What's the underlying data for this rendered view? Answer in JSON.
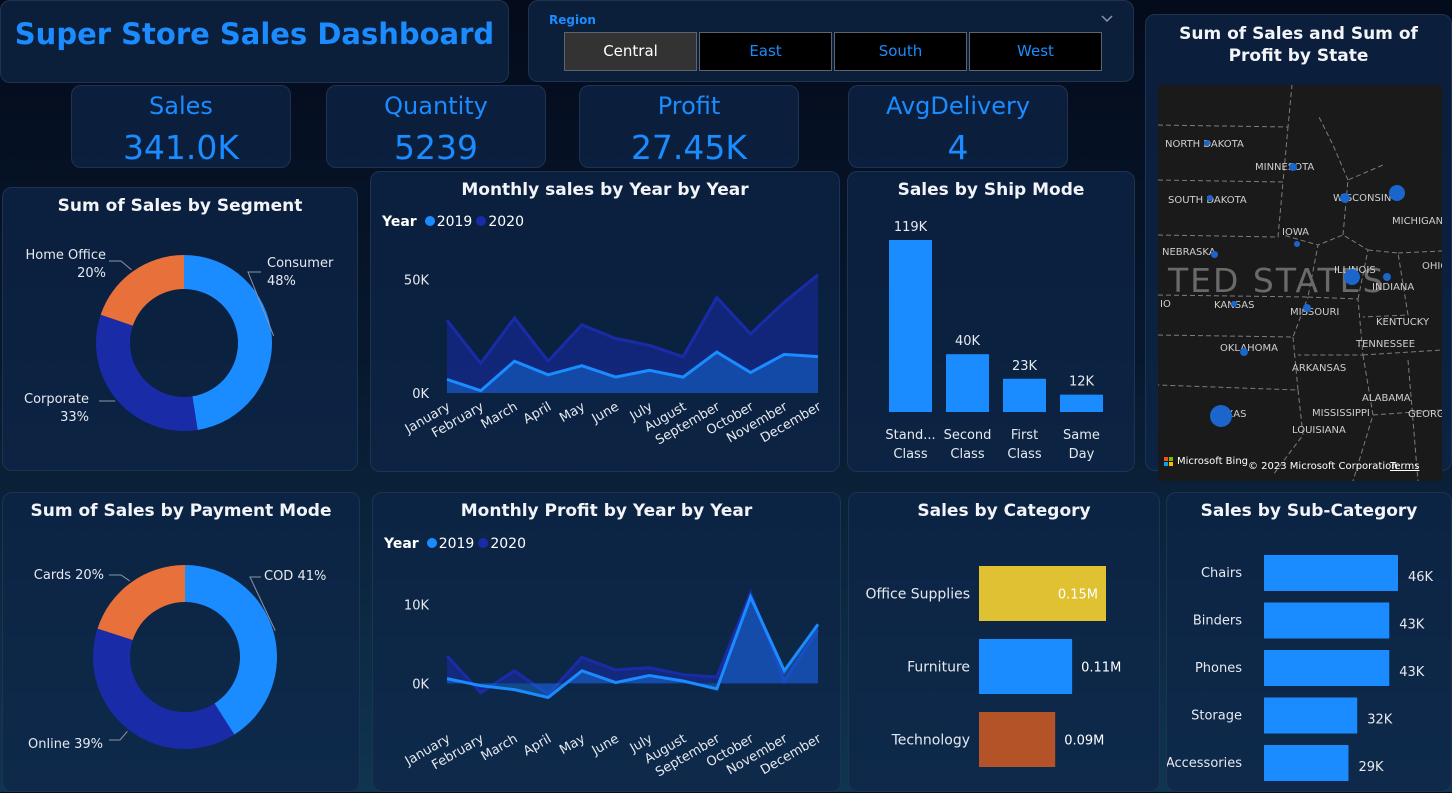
{
  "header": {
    "title": "Super Store Sales Dashboard"
  },
  "slicer": {
    "title": "Region",
    "options": [
      "Central",
      "East",
      "South",
      "West"
    ],
    "selected": "Central"
  },
  "kpis": [
    {
      "label": "Sales",
      "value": "341.0K"
    },
    {
      "label": "Quantity",
      "value": "5239"
    },
    {
      "label": "Profit",
      "value": "27.45K"
    },
    {
      "label": "AvgDelivery",
      "value": "4"
    }
  ],
  "colors": {
    "bright_blue": "#1a8cff",
    "navy": "#1a2ba8",
    "orange": "#e8703a",
    "yellow": "#e0c132",
    "rust": "#b45228"
  },
  "map": {
    "title": "Sum of Sales and Sum of Profit by State",
    "country_label": "TED STATES",
    "states": [
      "NORTH DAKOTA",
      "MINNESOTA",
      "WISCONSIN",
      "MICHIGAN",
      "SOUTH DAKOTA",
      "IOWA",
      "NEBRASKA",
      "ILLINOIS",
      "INDIANA",
      "OHIO",
      "KANSAS",
      "MISSOURI",
      "KENTUCKY",
      "TENNESSEE",
      "OKLAHOMA",
      "ARKANSAS",
      "ALABAMA",
      "MISSISSIPPI",
      "GEORGIA",
      "TEXAS",
      "LOUISIANA",
      "IO"
    ],
    "bing": "Microsoft Bing",
    "copyright": "© 2023 Microsoft Corporation",
    "terms": "Terms"
  },
  "charts": {
    "segment": {
      "title": "Sum of Sales by Segment",
      "chart_data": {
        "type": "pie",
        "slices": [
          {
            "label": "Consumer",
            "pct": "48%",
            "value": 48,
            "color": "#1a8cff"
          },
          {
            "label": "Corporate",
            "pct": "33%",
            "value": 33,
            "color": "#1a2ba8"
          },
          {
            "label": "Home Office",
            "pct": "20%",
            "value": 20,
            "color": "#e8703a"
          }
        ]
      }
    },
    "monthly_sales": {
      "title": "Monthly sales by Year by Year",
      "legend_title": "Year",
      "chart_data": {
        "type": "area",
        "categories": [
          "January",
          "February",
          "March",
          "April",
          "May",
          "June",
          "July",
          "August",
          "September",
          "October",
          "November",
          "December"
        ],
        "series": [
          {
            "name": "2019",
            "values": [
              6,
              1,
              14,
              8,
              12,
              7,
              10,
              7,
              18,
              9,
              17,
              16
            ],
            "color": "#1a8cff"
          },
          {
            "name": "2020",
            "values": [
              32,
              13,
              33,
              14,
              30,
              24,
              21,
              16,
              42,
              26,
              40,
              52
            ],
            "color": "#1a2ba8"
          }
        ],
        "yticks": [
          {
            "v": 0,
            "label": "0K"
          },
          {
            "v": 50,
            "label": "50K"
          }
        ],
        "ylim": [
          0,
          55
        ]
      }
    },
    "ship_mode": {
      "title": "Sales by Ship Mode",
      "chart_data": {
        "type": "bar",
        "categories": [
          [
            "Stand...",
            "Class"
          ],
          [
            "Second",
            "Class"
          ],
          [
            "First",
            "Class"
          ],
          [
            "Same",
            "Day"
          ]
        ],
        "values": [
          119,
          40,
          23,
          12
        ],
        "labels": [
          "119K",
          "40K",
          "23K",
          "12K"
        ],
        "color": "#1a8cff"
      }
    },
    "payment": {
      "title": "Sum of Sales by Payment Mode",
      "chart_data": {
        "type": "pie",
        "slices": [
          {
            "label": "COD",
            "pct": "41%",
            "value": 41,
            "color": "#1a8cff"
          },
          {
            "label": "Online",
            "pct": "39%",
            "value": 39,
            "color": "#1a2ba8"
          },
          {
            "label": "Cards",
            "pct": "20%",
            "value": 20,
            "color": "#e8703a"
          }
        ]
      }
    },
    "monthly_profit": {
      "title": "Monthly Profit by Year by Year",
      "legend_title": "Year",
      "chart_data": {
        "type": "area",
        "categories": [
          "January",
          "February",
          "March",
          "April",
          "May",
          "June",
          "July",
          "August",
          "September",
          "October",
          "November",
          "December"
        ],
        "series": [
          {
            "name": "2019",
            "values": [
              0.6,
              -0.3,
              -0.8,
              -1.8,
              1.6,
              0.1,
              1,
              0.3,
              -0.7,
              11,
              1.6,
              7.5
            ],
            "color": "#1a8cff"
          },
          {
            "name": "2020",
            "values": [
              3.5,
              -1.2,
              1.6,
              -1.4,
              3.3,
              1.7,
              2,
              1.1,
              0.8,
              11.5,
              0.3,
              6.8
            ],
            "color": "#1a2ba8"
          }
        ],
        "yticks": [
          {
            "v": 0,
            "label": "0K"
          },
          {
            "v": 10,
            "label": "10K"
          }
        ],
        "ylim": [
          -2.5,
          12
        ]
      }
    },
    "category": {
      "title": "Sales by Category",
      "chart_data": {
        "type": "bar",
        "orientation": "horizontal",
        "categories": [
          "Office Supplies",
          "Furniture",
          "Technology"
        ],
        "values": [
          0.15,
          0.11,
          0.09
        ],
        "labels": [
          "0.15M",
          "0.11M",
          "0.09M"
        ],
        "colors": [
          "#e0c132",
          "#1a8cff",
          "#b45228"
        ]
      }
    },
    "subcategory": {
      "title": "Sales by Sub-Category",
      "chart_data": {
        "type": "bar",
        "orientation": "horizontal",
        "categories": [
          "Chairs",
          "Binders",
          "Phones",
          "Storage",
          "Accessories"
        ],
        "values": [
          46,
          43,
          43,
          32,
          29
        ],
        "labels": [
          "46K",
          "43K",
          "43K",
          "32K",
          "29K"
        ],
        "color": "#1a8cff"
      }
    }
  }
}
